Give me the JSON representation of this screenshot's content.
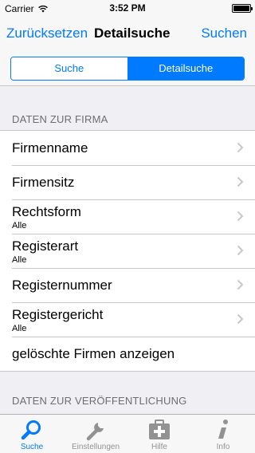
{
  "status_bar": {
    "carrier": "Carrier",
    "time": "3:52 PM"
  },
  "nav": {
    "left_button": "Zurücksetzen",
    "title": "Detailsuche",
    "right_button": "Suchen"
  },
  "segments": {
    "first": "Suche",
    "second": "Detailsuche",
    "selected": "Detailsuche"
  },
  "section1": {
    "title": "DATEN ZUR FIRMA"
  },
  "rows": [
    {
      "label": "Firmenname",
      "value": "",
      "chevron": true
    },
    {
      "label": "Firmensitz",
      "value": "",
      "chevron": true
    },
    {
      "label": "Rechtsform",
      "value": "Alle",
      "chevron": true
    },
    {
      "label": "Registerart",
      "value": "Alle",
      "chevron": true
    },
    {
      "label": "Registernummer",
      "value": "",
      "chevron": true
    },
    {
      "label": "Registergericht",
      "value": "Alle",
      "chevron": true
    },
    {
      "label": "gelöschte Firmen anzeigen",
      "value": "",
      "chevron": false
    }
  ],
  "section2": {
    "title": "DATEN ZUR VERÖFFENTLICHUNG"
  },
  "tabs": [
    {
      "label": "Suche",
      "icon": "search-icon",
      "active": true
    },
    {
      "label": "Einstellungen",
      "icon": "wrench-icon",
      "active": false
    },
    {
      "label": "Hilfe",
      "icon": "first-aid-kit-icon",
      "active": false
    },
    {
      "label": "Info",
      "icon": "info-icon",
      "active": false
    }
  ],
  "colors": {
    "accent": "#007aff",
    "inactive_tab": "#929292",
    "background": "#efeff4"
  }
}
